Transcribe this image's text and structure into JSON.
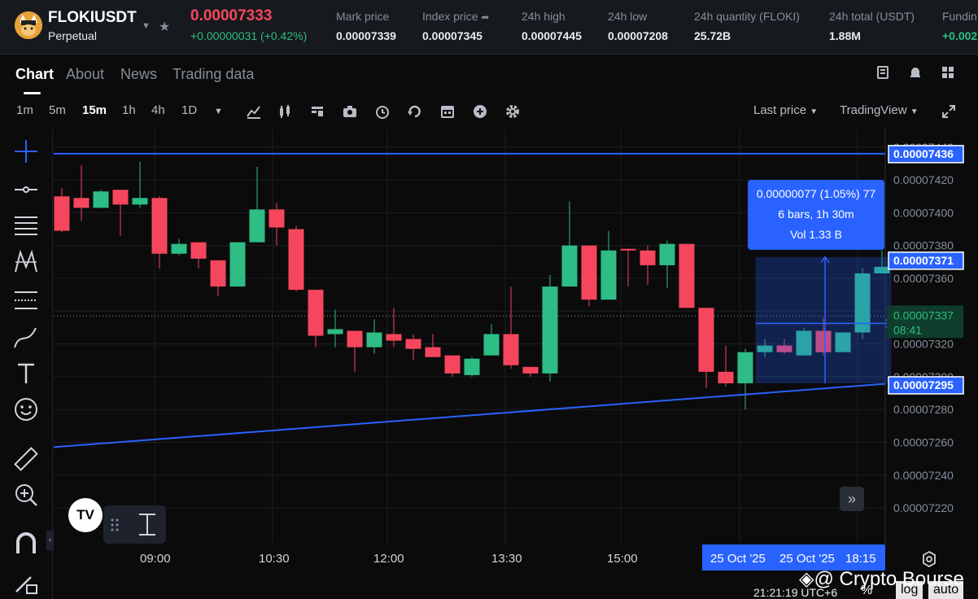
{
  "header": {
    "symbol": "FLOKIUSDT",
    "contract": "Perpetual",
    "last_price": "0.00007333",
    "change": "+0.00000031 (+0.42%)",
    "stats": [
      {
        "label": "Mark price",
        "value": "0.00007339"
      },
      {
        "label": "Index price",
        "value": "0.00007345"
      },
      {
        "label": "24h high",
        "value": "0.00007445"
      },
      {
        "label": "24h low",
        "value": "0.00007208"
      },
      {
        "label": "24h quantity (FLOKI)",
        "value": "25.72B"
      },
      {
        "label": "24h total (USDT)",
        "value": "1.88M"
      },
      {
        "label": "Fundin",
        "value": "+0.002"
      }
    ]
  },
  "tabs": [
    "Chart",
    "About",
    "News",
    "Trading data"
  ],
  "toolbar": {
    "timeframes": [
      "1m",
      "5m",
      "15m",
      "1h",
      "4h",
      "1D"
    ],
    "active_timeframe": "15m",
    "price_source": "Last price",
    "view_mode": "TradingView"
  },
  "icons": {
    "left_tools": [
      "crosshair-icon",
      "horizontal-line-icon",
      "fib-lines-icon",
      "pattern-icon",
      "gann-icon",
      "brush-icon",
      "text-icon",
      "emoji-icon",
      "ruler-icon",
      "zoom-in-icon",
      "magnet-icon",
      "lock-draw-icon"
    ]
  },
  "colors": {
    "up": "#2ebd85",
    "down": "#f6465d",
    "line": "#2962ff",
    "background": "#0b0b0b"
  },
  "chart_data": {
    "type": "candlestick",
    "y_ticks": [
      "0.00007440",
      "0.00007420",
      "0.00007400",
      "0.00007380",
      "0.00007360",
      "0.00007340",
      "0.00007320",
      "0.00007300",
      "0.00007280",
      "0.00007260",
      "0.00007240",
      "0.00007220"
    ],
    "x_ticks": [
      "09:00",
      "10:30",
      "12:00",
      "13:30",
      "15:00"
    ],
    "ylim": [
      7.21e-05,
      7.45e-05
    ],
    "candles": [
      {
        "o": 7.41e-05,
        "h": 7.415e-05,
        "l": 7.388e-05,
        "c": 7.389e-05
      },
      {
        "o": 7.409e-05,
        "h": 7.429e-05,
        "l": 7.395e-05,
        "c": 7.403e-05
      },
      {
        "o": 7.403e-05,
        "h": 7.414e-05,
        "l": 7.403e-05,
        "c": 7.413e-05
      },
      {
        "o": 7.414e-05,
        "h": 7.414e-05,
        "l": 7.386e-05,
        "c": 7.405e-05
      },
      {
        "o": 7.405e-05,
        "h": 7.431e-05,
        "l": 7.403e-05,
        "c": 7.409e-05
      },
      {
        "o": 7.409e-05,
        "h": 7.41e-05,
        "l": 7.366e-05,
        "c": 7.375e-05
      },
      {
        "o": 7.375e-05,
        "h": 7.384e-05,
        "l": 7.374e-05,
        "c": 7.381e-05
      },
      {
        "o": 7.382e-05,
        "h": 7.382e-05,
        "l": 7.366e-05,
        "c": 7.372e-05
      },
      {
        "o": 7.371e-05,
        "h": 7.371e-05,
        "l": 7.349e-05,
        "c": 7.355e-05
      },
      {
        "o": 7.355e-05,
        "h": 7.382e-05,
        "l": 7.355e-05,
        "c": 7.382e-05
      },
      {
        "o": 7.382e-05,
        "h": 7.428e-05,
        "l": 7.382e-05,
        "c": 7.402e-05
      },
      {
        "o": 7.402e-05,
        "h": 7.406e-05,
        "l": 7.38e-05,
        "c": 7.391e-05
      },
      {
        "o": 7.39e-05,
        "h": 7.392e-05,
        "l": 7.352e-05,
        "c": 7.353e-05
      },
      {
        "o": 7.353e-05,
        "h": 7.353e-05,
        "l": 7.318e-05,
        "c": 7.325e-05
      },
      {
        "o": 7.326e-05,
        "h": 7.341e-05,
        "l": 7.318e-05,
        "c": 7.329e-05
      },
      {
        "o": 7.328e-05,
        "h": 7.328e-05,
        "l": 7.303e-05,
        "c": 7.318e-05
      },
      {
        "o": 7.318e-05,
        "h": 7.335e-05,
        "l": 7.314e-05,
        "c": 7.327e-05
      },
      {
        "o": 7.326e-05,
        "h": 7.342e-05,
        "l": 7.318e-05,
        "c": 7.322e-05
      },
      {
        "o": 7.323e-05,
        "h": 7.326e-05,
        "l": 7.31e-05,
        "c": 7.317e-05
      },
      {
        "o": 7.318e-05,
        "h": 7.326e-05,
        "l": 7.312e-05,
        "c": 7.312e-05
      },
      {
        "o": 7.313e-05,
        "h": 7.313e-05,
        "l": 7.3e-05,
        "c": 7.302e-05
      },
      {
        "o": 7.301e-05,
        "h": 7.312e-05,
        "l": 7.3e-05,
        "c": 7.311e-05
      },
      {
        "o": 7.313e-05,
        "h": 7.332e-05,
        "l": 7.313e-05,
        "c": 7.326e-05
      },
      {
        "o": 7.326e-05,
        "h": 7.355e-05,
        "l": 7.305e-05,
        "c": 7.307e-05
      },
      {
        "o": 7.306e-05,
        "h": 7.306e-05,
        "l": 7.3e-05,
        "c": 7.302e-05
      },
      {
        "o": 7.302e-05,
        "h": 7.362e-05,
        "l": 7.297e-05,
        "c": 7.355e-05
      },
      {
        "o": 7.355e-05,
        "h": 7.407e-05,
        "l": 7.355e-05,
        "c": 7.38e-05
      },
      {
        "o": 7.38e-05,
        "h": 7.38e-05,
        "l": 7.343e-05,
        "c": 7.347e-05
      },
      {
        "o": 7.347e-05,
        "h": 7.389e-05,
        "l": 7.347e-05,
        "c": 7.377e-05
      },
      {
        "o": 7.378e-05,
        "h": 7.378e-05,
        "l": 7.355e-05,
        "c": 7.377e-05
      },
      {
        "o": 7.377e-05,
        "h": 7.38e-05,
        "l": 7.356e-05,
        "c": 7.368e-05
      },
      {
        "o": 7.368e-05,
        "h": 7.383e-05,
        "l": 7.354e-05,
        "c": 7.381e-05
      },
      {
        "o": 7.381e-05,
        "h": 7.381e-05,
        "l": 7.342e-05,
        "c": 7.342e-05
      },
      {
        "o": 7.342e-05,
        "h": 7.342e-05,
        "l": 7.293e-05,
        "c": 7.303e-05
      },
      {
        "o": 7.303e-05,
        "h": 7.319e-05,
        "l": 7.294e-05,
        "c": 7.296e-05
      },
      {
        "o": 7.296e-05,
        "h": 7.317e-05,
        "l": 7.28e-05,
        "c": 7.315e-05
      },
      {
        "o": 7.315e-05,
        "h": 7.323e-05,
        "l": 7.312e-05,
        "c": 7.319e-05
      },
      {
        "o": 7.319e-05,
        "h": 7.323e-05,
        "l": 7.314e-05,
        "c": 7.315e-05
      },
      {
        "o": 7.313e-05,
        "h": 7.33e-05,
        "l": 7.313e-05,
        "c": 7.328e-05
      },
      {
        "o": 7.328e-05,
        "h": 7.336e-05,
        "l": 7.313e-05,
        "c": 7.315e-05
      },
      {
        "o": 7.315e-05,
        "h": 7.327e-05,
        "l": 7.315e-05,
        "c": 7.327e-05
      },
      {
        "o": 7.327e-05,
        "h": 7.366e-05,
        "l": 7.323e-05,
        "c": 7.363e-05
      },
      {
        "o": 7.363e-05,
        "h": 7.377e-05,
        "l": 7.363e-05,
        "c": 7.367e-05
      }
    ],
    "horizontal_line": 7.436e-05,
    "trend_line": [
      {
        "bar": -0.5,
        "price": 7.257e-05
      },
      {
        "bar": 42.5,
        "price": 7.296e-05
      }
    ],
    "current_price": 7.337e-05,
    "price_tags": [
      {
        "value": "0.00007436",
        "price": 7.436e-05
      },
      {
        "value": "0.00007371",
        "price": 7.371e-05
      },
      {
        "value": "0.00007295",
        "price": 7.295e-05
      }
    ],
    "current_tag": {
      "value": "0.00007337",
      "countdown": "08:41"
    },
    "measure": {
      "line1": "0.00000077 (1.05%) 77",
      "line2": "6 bars, 1h 30m",
      "line3": "Vol 1.33 B",
      "from_bar": 36,
      "to_bar": 42,
      "from_price": 7.296e-05,
      "to_price": 7.373e-05
    }
  },
  "x_highlight": [
    "25 Oct '25",
    "25 Oct '25",
    "18:15"
  ],
  "footer": {
    "clock": "21:21:19 UTC+6",
    "pct": "%",
    "log": "log",
    "auto": "auto"
  },
  "watermark": "@ Crypto Bourse"
}
